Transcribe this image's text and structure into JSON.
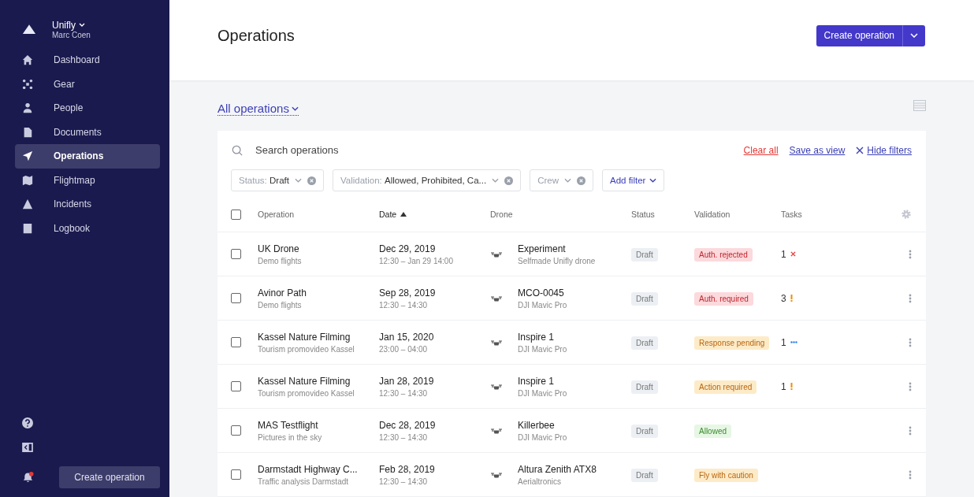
{
  "sidebar": {
    "org": "Unifly",
    "user": "Marc Coen",
    "items": [
      {
        "label": "Dashboard",
        "selected": false
      },
      {
        "label": "Gear",
        "selected": false
      },
      {
        "label": "People",
        "selected": false
      },
      {
        "label": "Documents",
        "selected": false
      },
      {
        "label": "Operations",
        "selected": true
      },
      {
        "label": "Flightmap",
        "selected": false
      },
      {
        "label": "Incidents",
        "selected": false
      },
      {
        "label": "Logbook",
        "selected": false
      }
    ],
    "notifications_unread": true,
    "create_button": "Create operation"
  },
  "header": {
    "title": "Operations",
    "create_button": "Create operation"
  },
  "view_selector": "All operations",
  "search": {
    "placeholder": "Search operations"
  },
  "filter_links": {
    "clear": "Clear all",
    "save": "Save as view",
    "hide": "Hide filters"
  },
  "filters": [
    {
      "label": "Status:",
      "value": "Draft"
    },
    {
      "label": "Validation:",
      "value": "Allowed, Prohibited, Ca..."
    },
    {
      "label": "Crew"
    }
  ],
  "add_filter": "Add filter",
  "table": {
    "columns": [
      "Operation",
      "Date",
      "Drone",
      "Status",
      "Validation",
      "Tasks"
    ],
    "header_checked": false,
    "rows": [
      {
        "checked": false,
        "name": "UK Drone",
        "sub": "Demo flights",
        "date": "Dec 29, 2019",
        "time": "12:30 – Jan 29 14:00",
        "drone": "Experiment",
        "model": "Selfmade Unifly drone",
        "status": "Draft",
        "validation": {
          "label": "Auth. rejected",
          "kind": "danger"
        },
        "tasks": {
          "count": "1",
          "kind": "error"
        }
      },
      {
        "checked": false,
        "name": "Avinor Path",
        "sub": "Demo flights",
        "date": "Sep 28, 2019",
        "time": "12:30 – 14:30",
        "drone": "MCO-0045",
        "model": "DJI Mavic Pro",
        "status": "Draft",
        "validation": {
          "label": "Auth. required",
          "kind": "danger"
        },
        "tasks": {
          "count": "3",
          "kind": "warning"
        }
      },
      {
        "checked": false,
        "name": "Kassel Nature Filming",
        "sub": "Tourism promovideo Kassel",
        "date": "Jan 15, 2020",
        "time": "23:00 – 04:00",
        "drone": "Inspire 1",
        "model": "DJI Mavic Pro",
        "status": "Draft",
        "validation": {
          "label": "Response pending",
          "kind": "warning"
        },
        "tasks": {
          "count": "1",
          "kind": "pending"
        }
      },
      {
        "checked": false,
        "name": "Kassel Nature Filming",
        "sub": "Tourism promovideo Kassel",
        "date": "Jan 28, 2019",
        "time": "12:30 – 14:30",
        "drone": "Inspire 1",
        "model": "DJI Mavic Pro",
        "status": "Draft",
        "validation": {
          "label": "Action required",
          "kind": "warning"
        },
        "tasks": {
          "count": "1",
          "kind": "warning"
        }
      },
      {
        "checked": false,
        "name": "MAS Testflight",
        "sub": "Pictures in the sky",
        "date": "Dec 28, 2019",
        "time": "12:30 – 14:30",
        "drone": "Killerbee",
        "model": "DJI Mavic Pro",
        "status": "Draft",
        "validation": {
          "label": "Allowed",
          "kind": "success"
        }
      },
      {
        "checked": false,
        "name": "Darmstadt Highway C...",
        "sub": "Traffic analysis Darmstadt",
        "date": "Feb 28, 2019",
        "time": "12:30 – 14:30",
        "drone": "Altura Zenith ATX8",
        "model": "Aerialtronics",
        "status": "Draft",
        "validation": {
          "label": "Fly with caution",
          "kind": "warning"
        }
      }
    ]
  }
}
